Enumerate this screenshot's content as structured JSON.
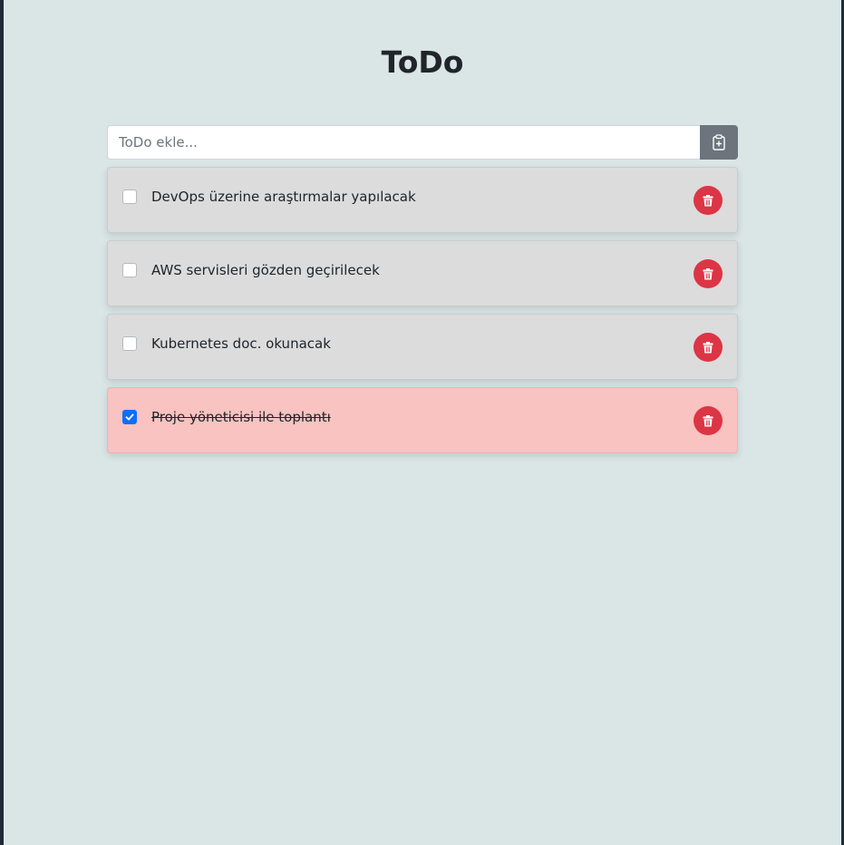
{
  "header": {
    "title": "ToDo"
  },
  "input": {
    "value": "",
    "placeholder": "ToDo ekle...",
    "add_icon": "clipboard-plus-icon"
  },
  "todos": [
    {
      "text": "DevOps üzerine araştırmalar yapılacak",
      "completed": false
    },
    {
      "text": "AWS servisleri gözden geçirilecek",
      "completed": false
    },
    {
      "text": "Kubernetes doc. okunacak",
      "completed": false
    },
    {
      "text": "Proje yöneticisi ile toplantı",
      "completed": true
    }
  ],
  "icons": {
    "delete": "trash-icon",
    "check": "checkmark-icon"
  },
  "colors": {
    "background": "#dae5e6",
    "item_background": "#dcdcdc",
    "completed_item_background": "#f8c3c0",
    "delete_button": "#dc3545",
    "add_button": "#6c757d",
    "checkbox_checked": "#0d6efd"
  }
}
